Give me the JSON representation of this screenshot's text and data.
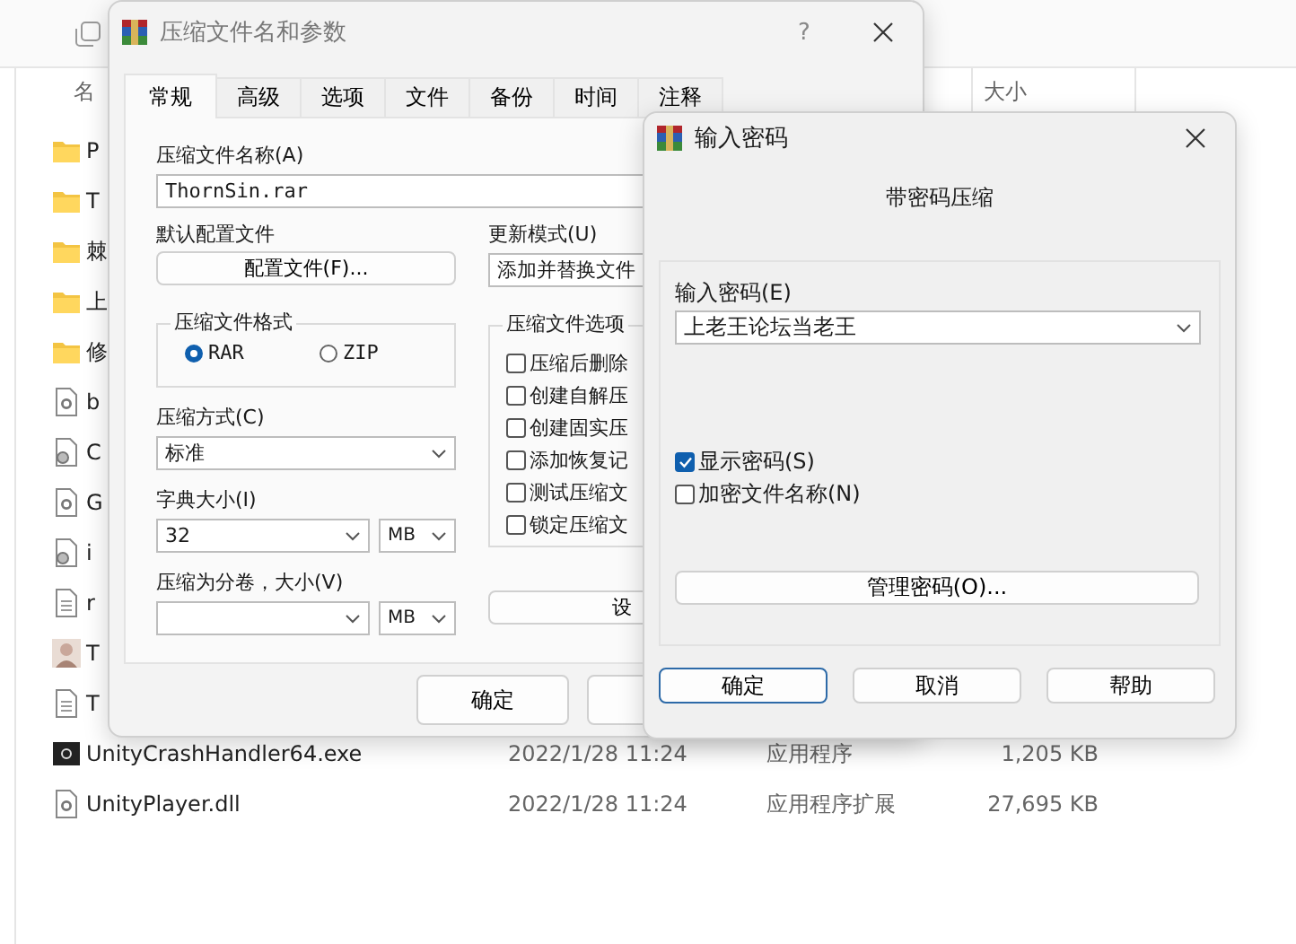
{
  "explorer": {
    "columns": [
      {
        "label": "名"
      },
      {
        "label": "大小"
      }
    ],
    "files": [
      {
        "name": "P",
        "kind": "folder"
      },
      {
        "name": "T",
        "kind": "folder"
      },
      {
        "name": "棘",
        "kind": "folder"
      },
      {
        "name": "上",
        "kind": "folder"
      },
      {
        "name": "修",
        "kind": "folder"
      },
      {
        "name": "b",
        "kind": "dll"
      },
      {
        "name": "C",
        "kind": "config"
      },
      {
        "name": "G",
        "kind": "dll"
      },
      {
        "name": "i",
        "kind": "config"
      },
      {
        "name": "r",
        "kind": "text"
      },
      {
        "name": "T",
        "kind": "person"
      },
      {
        "name": "T",
        "kind": "text"
      },
      {
        "name": "UnityCrashHandler64.exe",
        "kind": "exe",
        "date": "2022/1/28 11:24",
        "type": "应用程序",
        "size": "1,205 KB"
      },
      {
        "name": "UnityPlayer.dll",
        "kind": "dll",
        "date": "2022/1/28 11:24",
        "type": "应用程序扩展",
        "size": "27,695 KB"
      }
    ]
  },
  "archive_dialog": {
    "title": "压缩文件名和参数",
    "help_button": "?",
    "tabs": [
      {
        "label": "常规",
        "selected": true
      },
      {
        "label": "高级",
        "selected": false
      },
      {
        "label": "选项",
        "selected": false
      },
      {
        "label": "文件",
        "selected": false
      },
      {
        "label": "备份",
        "selected": false
      },
      {
        "label": "时间",
        "selected": false
      },
      {
        "label": "注释",
        "selected": false
      }
    ],
    "archive_name": {
      "label": "压缩文件名称(A)",
      "value": "ThornSin.rar"
    },
    "profile": {
      "label": "默认配置文件",
      "button": "配置文件(F)..."
    },
    "update_mode": {
      "label": "更新模式(U)",
      "value": "添加并替换文件"
    },
    "format": {
      "label": "压缩文件格式",
      "options": [
        {
          "label": "RAR",
          "selected": true
        },
        {
          "label": "ZIP",
          "selected": false
        }
      ]
    },
    "method": {
      "label": "压缩方式(C)",
      "value": "标准"
    },
    "dictionary": {
      "label": "字典大小(I)",
      "value": "32",
      "unit": "MB"
    },
    "volumes": {
      "label": "压缩为分卷，大小(V)",
      "unit": "MB"
    },
    "options": {
      "label": "压缩文件选项",
      "items": [
        {
          "label": "压缩后删除",
          "checked": false
        },
        {
          "label": "创建自解压",
          "checked": false
        },
        {
          "label": "创建固实压",
          "checked": false
        },
        {
          "label": "添加恢复记",
          "checked": false
        },
        {
          "label": "测试压缩文",
          "checked": false
        },
        {
          "label": "锁定压缩文",
          "checked": false
        }
      ]
    },
    "settings_button": "设",
    "buttons": [
      {
        "label": "确定"
      }
    ]
  },
  "password_dialog": {
    "title": "输入密码",
    "heading": "带密码压缩",
    "password": {
      "label": "输入密码(E)",
      "value": "上老王论坛当老王"
    },
    "checkboxes": [
      {
        "label": "显示密码(S)",
        "checked": true
      },
      {
        "label": "加密文件名称(N)",
        "checked": false
      }
    ],
    "manage_button": "管理密码(O)...",
    "buttons": [
      {
        "label": "确定",
        "default": true
      },
      {
        "label": "取消",
        "default": false
      },
      {
        "label": "帮助",
        "default": false
      }
    ]
  }
}
